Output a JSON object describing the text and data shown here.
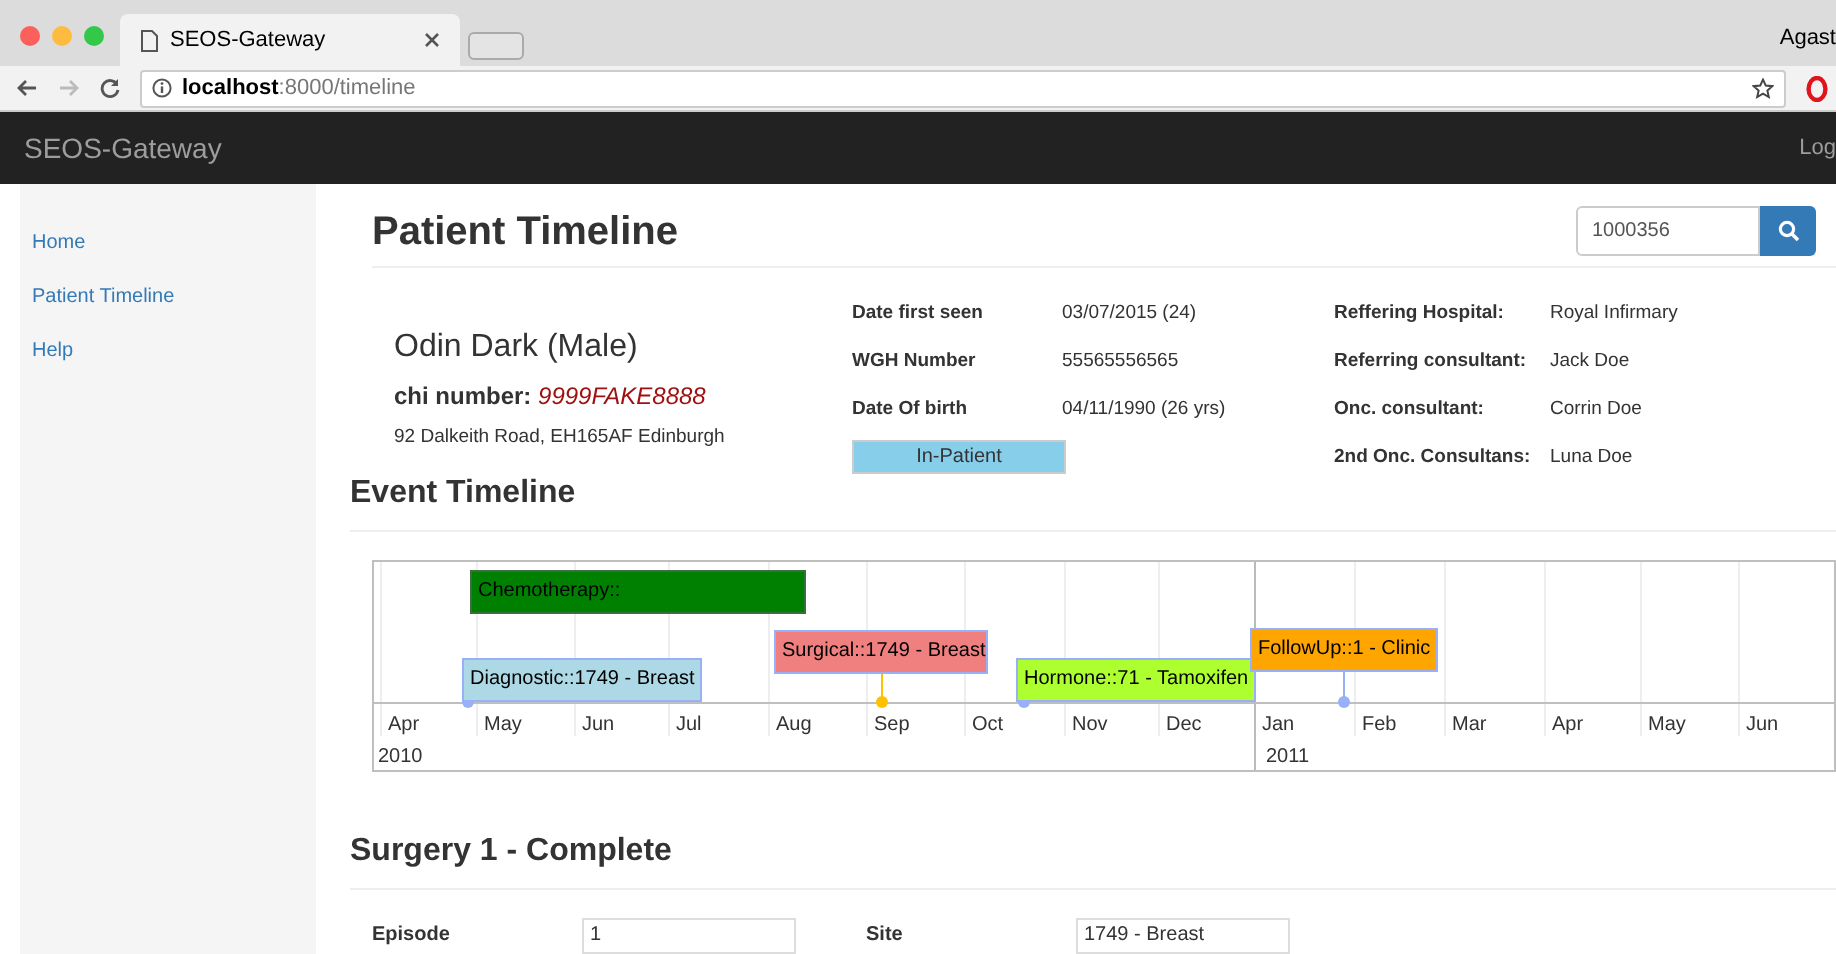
{
  "browser": {
    "tab_title": "SEOS-Gateway",
    "url_host": "localhost",
    "url_path": ":8000/timeline",
    "profile": "Agast"
  },
  "navbar": {
    "brand": "SEOS-Gateway",
    "right_link": "Log"
  },
  "sidebar": {
    "items": [
      {
        "label": "Home",
        "selected": false
      },
      {
        "label": "Patient Timeline",
        "selected": false
      },
      {
        "label": "Help",
        "selected": false
      }
    ]
  },
  "page": {
    "title": "Patient Timeline",
    "search": {
      "value": "1000356"
    }
  },
  "patient": {
    "name": "Odin Dark (Male)",
    "chi_label": "chi number:",
    "chi_value": "9999FAKE8888",
    "address": "92 Dalkeith Road, EH165AF Edinburgh",
    "details": [
      {
        "label": "Date first seen",
        "value": "03/07/2015 (24)"
      },
      {
        "label": "WGH Number",
        "value": "55565556565"
      },
      {
        "label": "Date Of birth",
        "value": "04/11/1990 (26 yrs)"
      }
    ],
    "status": "In-Patient",
    "referrals": [
      {
        "label": "Reffering Hospital:",
        "value": "Royal Infirmary"
      },
      {
        "label": "Referring consultant:",
        "value": "Jack Doe"
      },
      {
        "label": "Onc. consultant:",
        "value": "Corrin Doe"
      },
      {
        "label": "2nd Onc. Consultans:",
        "value": "Luna Doe"
      }
    ]
  },
  "event_timeline": {
    "title": "Event Timeline",
    "months": [
      "Apr",
      "May",
      "Jun",
      "Jul",
      "Aug",
      "Sep",
      "Oct",
      "Nov",
      "Dec",
      "Jan",
      "Feb",
      "Mar",
      "Apr",
      "May",
      "Jun"
    ],
    "years": [
      {
        "label": "2010"
      },
      {
        "label": "2011"
      }
    ],
    "events": [
      {
        "label": "Chemotherapy::",
        "color": "#008000",
        "kind": "range"
      },
      {
        "label": "Diagnostic::1749 - Breast",
        "color": "#add8e6",
        "kind": "point"
      },
      {
        "label": "Surgical::1749 - Breast",
        "color": "#f08080",
        "kind": "point"
      },
      {
        "label": "Hormone::71 - Tamoxifen",
        "color": "#adff2f",
        "kind": "point"
      },
      {
        "label": "FollowUp::1 - Clinic",
        "color": "#ffa500",
        "kind": "point"
      }
    ]
  },
  "surgery": {
    "title": "Surgery 1 - Complete",
    "fields": [
      {
        "label": "Episode",
        "value": "1"
      },
      {
        "label": "Site",
        "value": "1749 - Breast"
      }
    ]
  }
}
